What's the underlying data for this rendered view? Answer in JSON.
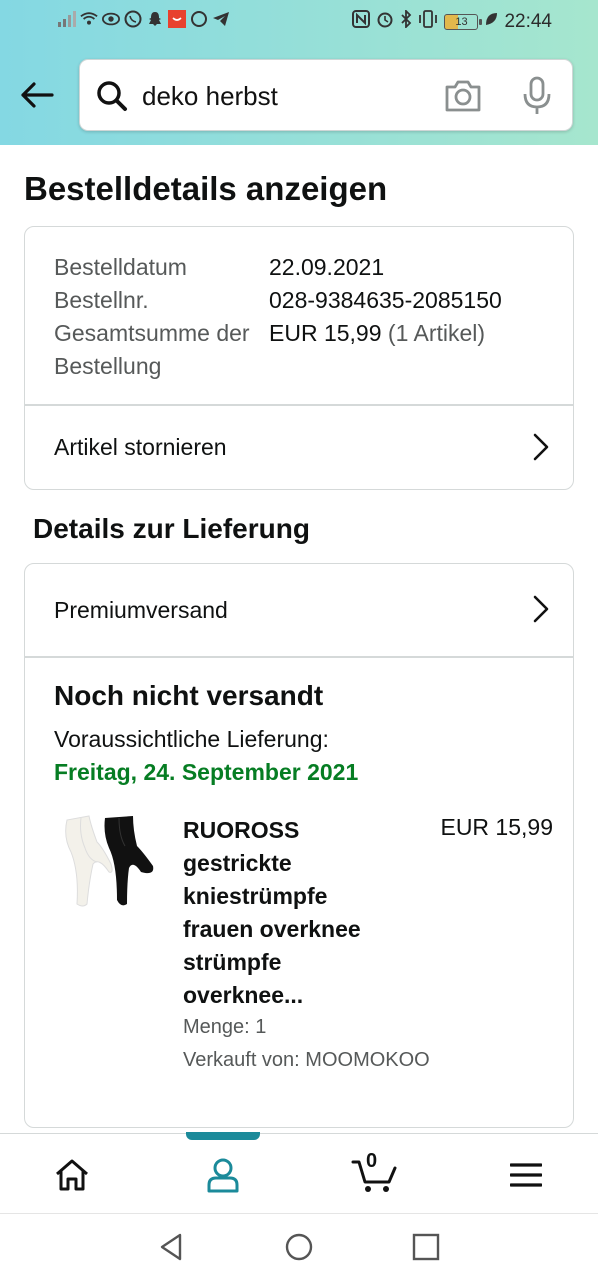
{
  "status_bar": {
    "time": "22:44",
    "battery": "13"
  },
  "search": {
    "value": "deko herbst"
  },
  "page": {
    "title": "Bestelldetails anzeigen"
  },
  "order_summary": {
    "rows": [
      {
        "label": "Bestelldatum",
        "value": "22.09.2021",
        "extra": ""
      },
      {
        "label": "Bestellnr.",
        "value": "028-9384635-2085150",
        "extra": ""
      },
      {
        "label": "Gesamtsumme der Bestellung",
        "value": "EUR 15,99",
        "extra": "(1 Artikel)"
      }
    ],
    "cancel_label": "Artikel stornieren"
  },
  "delivery": {
    "section_title": "Details zur Lieferung",
    "shipping_method": "Premiumversand",
    "status": "Noch nicht versandt",
    "expected_label": "Voraussichtliche Lieferung:",
    "expected_date": "Freitag, 24. September 2021",
    "item": {
      "title": "RUOROSS gestrickte kniestrümpfe frauen overknee strümpfe overknee...",
      "price": "EUR 15,99",
      "quantity": "Menge: 1",
      "seller": "Verkauft von: MOOMOKOO"
    }
  },
  "bottom_nav": {
    "cart_count": "0",
    "active": "account"
  },
  "colors": {
    "header_start": "#84d8e3",
    "header_end": "#a6e6ce",
    "delivery_green": "#067d23",
    "active_teal": "#1b8a9a"
  }
}
